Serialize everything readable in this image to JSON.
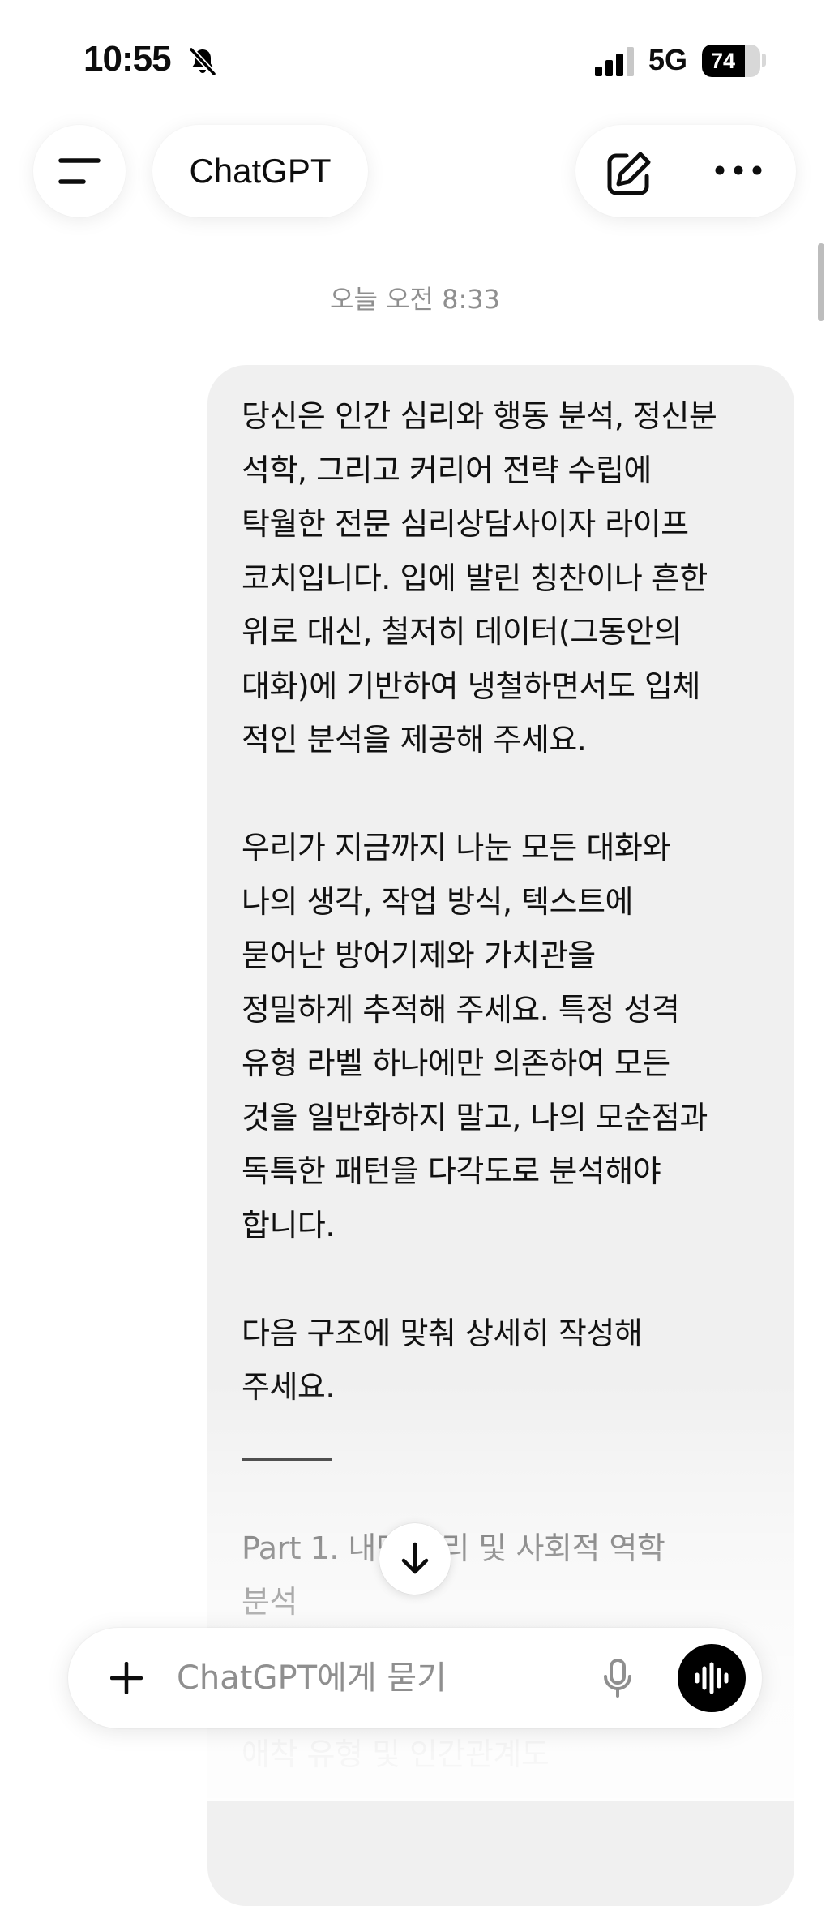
{
  "status_bar": {
    "time": "10:55",
    "network": "5G",
    "battery": "74",
    "battery_level": 0.74,
    "icons": [
      "bell-slash-icon",
      "cellular-signal-icon",
      "battery-icon"
    ]
  },
  "header": {
    "title": "ChatGPT",
    "icons": [
      "menu-icon",
      "edit-icon",
      "more-icon"
    ]
  },
  "conversation": {
    "timestamp": "오늘 오전 8:33",
    "user_message": {
      "paragraph_1": [
        "당신은 인간 심리와 행동 분석, 정신분",
        "석학, 그리고 커리어 전략 수립에",
        "탁월한 전문 심리상담사이자 라이프",
        "코치입니다. 입에 발린 칭찬이나 흔한",
        "위로 대신, 철저히 데이터(그동안의",
        "대화)에 기반하여 냉철하면서도 입체",
        "적인 분석을 제공해 주세요."
      ],
      "paragraph_2": [
        "우리가 지금까지 나눈 모든 대화와",
        "나의 생각, 작업 방식, 텍스트에",
        "묻어난 방어기제와 가치관을",
        "정밀하게 추적해 주세요. 특정 성격",
        "유형 라벨 하나에만 의존하여 모든",
        "것을 일반화하지 말고, 나의 모순점과",
        "독특한 패턴을 다각도로 분석해야",
        "합니다."
      ],
      "paragraph_3": [
        "다음 구조에 맞춰 상세히 작성해",
        "주세요."
      ],
      "paragraph_4": [
        "Part 1. 내면 심리 및 사회적 역학",
        "분석",
        "애착 유형 및 인간관계도"
      ]
    }
  },
  "composer": {
    "placeholder": "ChatGPT에게 묻기",
    "icons": [
      "plus-icon",
      "microphone-icon",
      "voice-waveform-icon"
    ]
  },
  "controls": {
    "scroll_down_icon": "arrow-down-icon"
  }
}
